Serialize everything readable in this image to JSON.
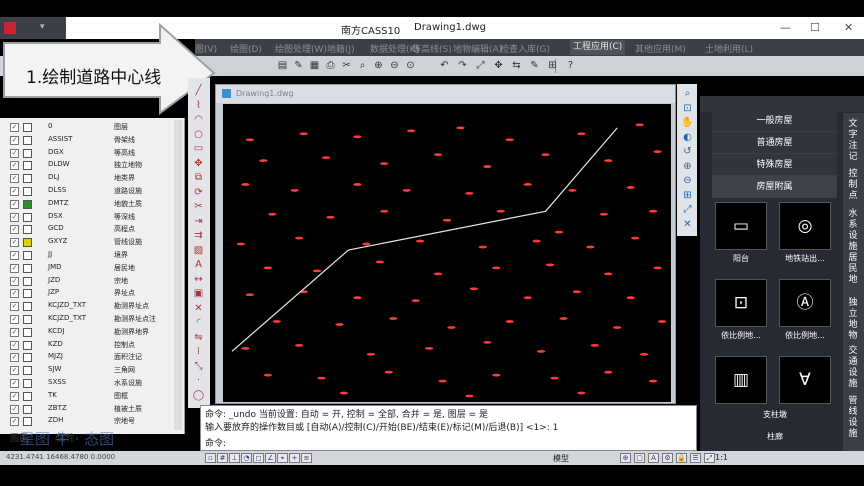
{
  "window": {
    "app_title": "南方CASS10",
    "file_title": "Drawing1.dwg",
    "min": "—",
    "max": "☐",
    "close": "✕"
  },
  "menu": [
    "图(V)",
    "绘图(D)",
    "绘图处理(W)",
    "地籍(J)",
    "数据处理(K)",
    "等高线(S)",
    "地物编辑(A)",
    "检查入库(G)",
    "工程应用(C)",
    "其他应用(M)",
    "土地利用(L)"
  ],
  "menu_active_index": 8,
  "annotation": {
    "text": "1.绘制道路中心线"
  },
  "doc": {
    "title": "Drawing1.dwg"
  },
  "layers": [
    {
      "name": "0",
      "desc": "图层",
      "color": "#ffffff"
    },
    {
      "name": "ASSIST",
      "desc": "骨架线",
      "color": "#ffffff"
    },
    {
      "name": "DGX",
      "desc": "等高线",
      "color": "#ffffff"
    },
    {
      "name": "DLDW",
      "desc": "独立地物",
      "color": "#ffffff"
    },
    {
      "name": "DLJ",
      "desc": "地类界",
      "color": "#ffffff"
    },
    {
      "name": "DLSS",
      "desc": "道路设施",
      "color": "#ffffff"
    },
    {
      "name": "DMTZ",
      "desc": "地貌土质",
      "color": "#2a8f2a"
    },
    {
      "name": "DSX",
      "desc": "等深线",
      "color": "#ffffff"
    },
    {
      "name": "GCD",
      "desc": "高程点",
      "color": "#ffffff"
    },
    {
      "name": "GXYZ",
      "desc": "管线设施",
      "color": "#e0d000"
    },
    {
      "name": "JJ",
      "desc": "境界",
      "color": "#ffffff"
    },
    {
      "name": "JMD",
      "desc": "居民地",
      "color": "#ffffff"
    },
    {
      "name": "JZD",
      "desc": "宗地",
      "color": "#ffffff"
    },
    {
      "name": "JZP",
      "desc": "界址点",
      "color": "#ffffff"
    },
    {
      "name": "KCJZD_TXT",
      "desc": "勘测界址点",
      "color": "#ffffff"
    },
    {
      "name": "KCJZD_TXT",
      "desc": "勘测界址点注",
      "color": "#ffffff"
    },
    {
      "name": "KCDJ",
      "desc": "勘测界地界",
      "color": "#ffffff"
    },
    {
      "name": "KZD",
      "desc": "控制点",
      "color": "#ffffff"
    },
    {
      "name": "MJZJ",
      "desc": "面积注记",
      "color": "#ffffff"
    },
    {
      "name": "SJW",
      "desc": "三角网",
      "color": "#ffffff"
    },
    {
      "name": "SXSS",
      "desc": "水系设施",
      "color": "#ffffff"
    },
    {
      "name": "TK",
      "desc": "图框",
      "color": "#ffffff"
    },
    {
      "name": "ZBTZ",
      "desc": "植被土质",
      "color": "#ffffff"
    },
    {
      "name": "ZDH",
      "desc": "宗地号",
      "color": "#ffffff"
    }
  ],
  "cmd": {
    "line1": "命令:  _undo 当前设置: 自动 = 开, 控制 = 全部, 合并 = 是, 图层 = 是",
    "line2": "输入要放弃的操作数目或 [自动(A)/控制(C)/开始(BE)/结束(E)/标记(M)/后退(B)] <1>: 1",
    "prompt": "命令:"
  },
  "right_panel": {
    "categories": [
      "一般房屋",
      "普通房屋",
      "特殊房屋",
      "房屋附属"
    ],
    "active_category": 3,
    "items": [
      {
        "label": "阳台",
        "glyph": "▭"
      },
      {
        "label": "地铁站出...",
        "glyph": "◎"
      },
      {
        "label": "依比例地...",
        "glyph": "⊡"
      },
      {
        "label": "依比例地...",
        "glyph": "Ⓐ"
      },
      {
        "label": "",
        "glyph": "▥"
      },
      {
        "label": "",
        "glyph": "∀"
      }
    ],
    "bottom_labels": [
      "支柱墩",
      "柱廊"
    ],
    "vtabs": [
      "文字注记",
      "控制点",
      "水系设施",
      "居民地",
      "独立地物",
      "交通设施",
      "管线设施"
    ]
  },
  "status": {
    "coords": "4231.4741  16468.4780  0.0000",
    "mode": "模型",
    "scale": "1:1"
  },
  "layer_tabs": {
    "tab1": "图层",
    "tab2": "属性"
  },
  "watermark": "星图 牛 · 态图",
  "chart_data": {
    "type": "scatter",
    "series": [
      {
        "values": [
          [
            0.02,
            0.83
          ],
          [
            0.28,
            0.49
          ],
          [
            0.72,
            0.36
          ],
          [
            0.88,
            0.08
          ]
        ]
      }
    ],
    "points": [
      [
        0.06,
        0.12
      ],
      [
        0.18,
        0.1
      ],
      [
        0.3,
        0.11
      ],
      [
        0.42,
        0.09
      ],
      [
        0.53,
        0.08
      ],
      [
        0.64,
        0.12
      ],
      [
        0.8,
        0.1
      ],
      [
        0.93,
        0.07
      ],
      [
        0.09,
        0.19
      ],
      [
        0.23,
        0.18
      ],
      [
        0.36,
        0.2
      ],
      [
        0.48,
        0.17
      ],
      [
        0.59,
        0.21
      ],
      [
        0.72,
        0.17
      ],
      [
        0.86,
        0.19
      ],
      [
        0.97,
        0.16
      ],
      [
        0.05,
        0.27
      ],
      [
        0.16,
        0.29
      ],
      [
        0.3,
        0.27
      ],
      [
        0.41,
        0.29
      ],
      [
        0.55,
        0.3
      ],
      [
        0.68,
        0.27
      ],
      [
        0.78,
        0.29
      ],
      [
        0.91,
        0.28
      ],
      [
        0.11,
        0.37
      ],
      [
        0.24,
        0.38
      ],
      [
        0.36,
        0.36
      ],
      [
        0.5,
        0.39
      ],
      [
        0.62,
        0.36
      ],
      [
        0.75,
        0.43
      ],
      [
        0.85,
        0.37
      ],
      [
        0.96,
        0.36
      ],
      [
        0.04,
        0.47
      ],
      [
        0.17,
        0.45
      ],
      [
        0.32,
        0.47
      ],
      [
        0.44,
        0.46
      ],
      [
        0.58,
        0.48
      ],
      [
        0.7,
        0.46
      ],
      [
        0.82,
        0.48
      ],
      [
        0.92,
        0.45
      ],
      [
        0.1,
        0.55
      ],
      [
        0.21,
        0.56
      ],
      [
        0.35,
        0.53
      ],
      [
        0.48,
        0.57
      ],
      [
        0.61,
        0.55
      ],
      [
        0.73,
        0.54
      ],
      [
        0.86,
        0.57
      ],
      [
        0.97,
        0.55
      ],
      [
        0.06,
        0.64
      ],
      [
        0.18,
        0.63
      ],
      [
        0.3,
        0.65
      ],
      [
        0.43,
        0.66
      ],
      [
        0.56,
        0.62
      ],
      [
        0.68,
        0.65
      ],
      [
        0.79,
        0.63
      ],
      [
        0.91,
        0.65
      ],
      [
        0.12,
        0.73
      ],
      [
        0.26,
        0.74
      ],
      [
        0.38,
        0.72
      ],
      [
        0.51,
        0.75
      ],
      [
        0.64,
        0.73
      ],
      [
        0.76,
        0.72
      ],
      [
        0.88,
        0.75
      ],
      [
        0.98,
        0.73
      ],
      [
        0.05,
        0.82
      ],
      [
        0.17,
        0.81
      ],
      [
        0.33,
        0.84
      ],
      [
        0.46,
        0.82
      ],
      [
        0.59,
        0.8
      ],
      [
        0.71,
        0.83
      ],
      [
        0.83,
        0.81
      ],
      [
        0.94,
        0.84
      ],
      [
        0.1,
        0.91
      ],
      [
        0.22,
        0.92
      ],
      [
        0.37,
        0.9
      ],
      [
        0.49,
        0.93
      ],
      [
        0.61,
        0.91
      ],
      [
        0.74,
        0.92
      ],
      [
        0.86,
        0.9
      ],
      [
        0.96,
        0.93
      ],
      [
        0.27,
        0.97
      ],
      [
        0.55,
        0.98
      ],
      [
        0.8,
        0.97
      ]
    ],
    "point_color": "#ff3b3b",
    "line_color": "#e6e6e6"
  }
}
